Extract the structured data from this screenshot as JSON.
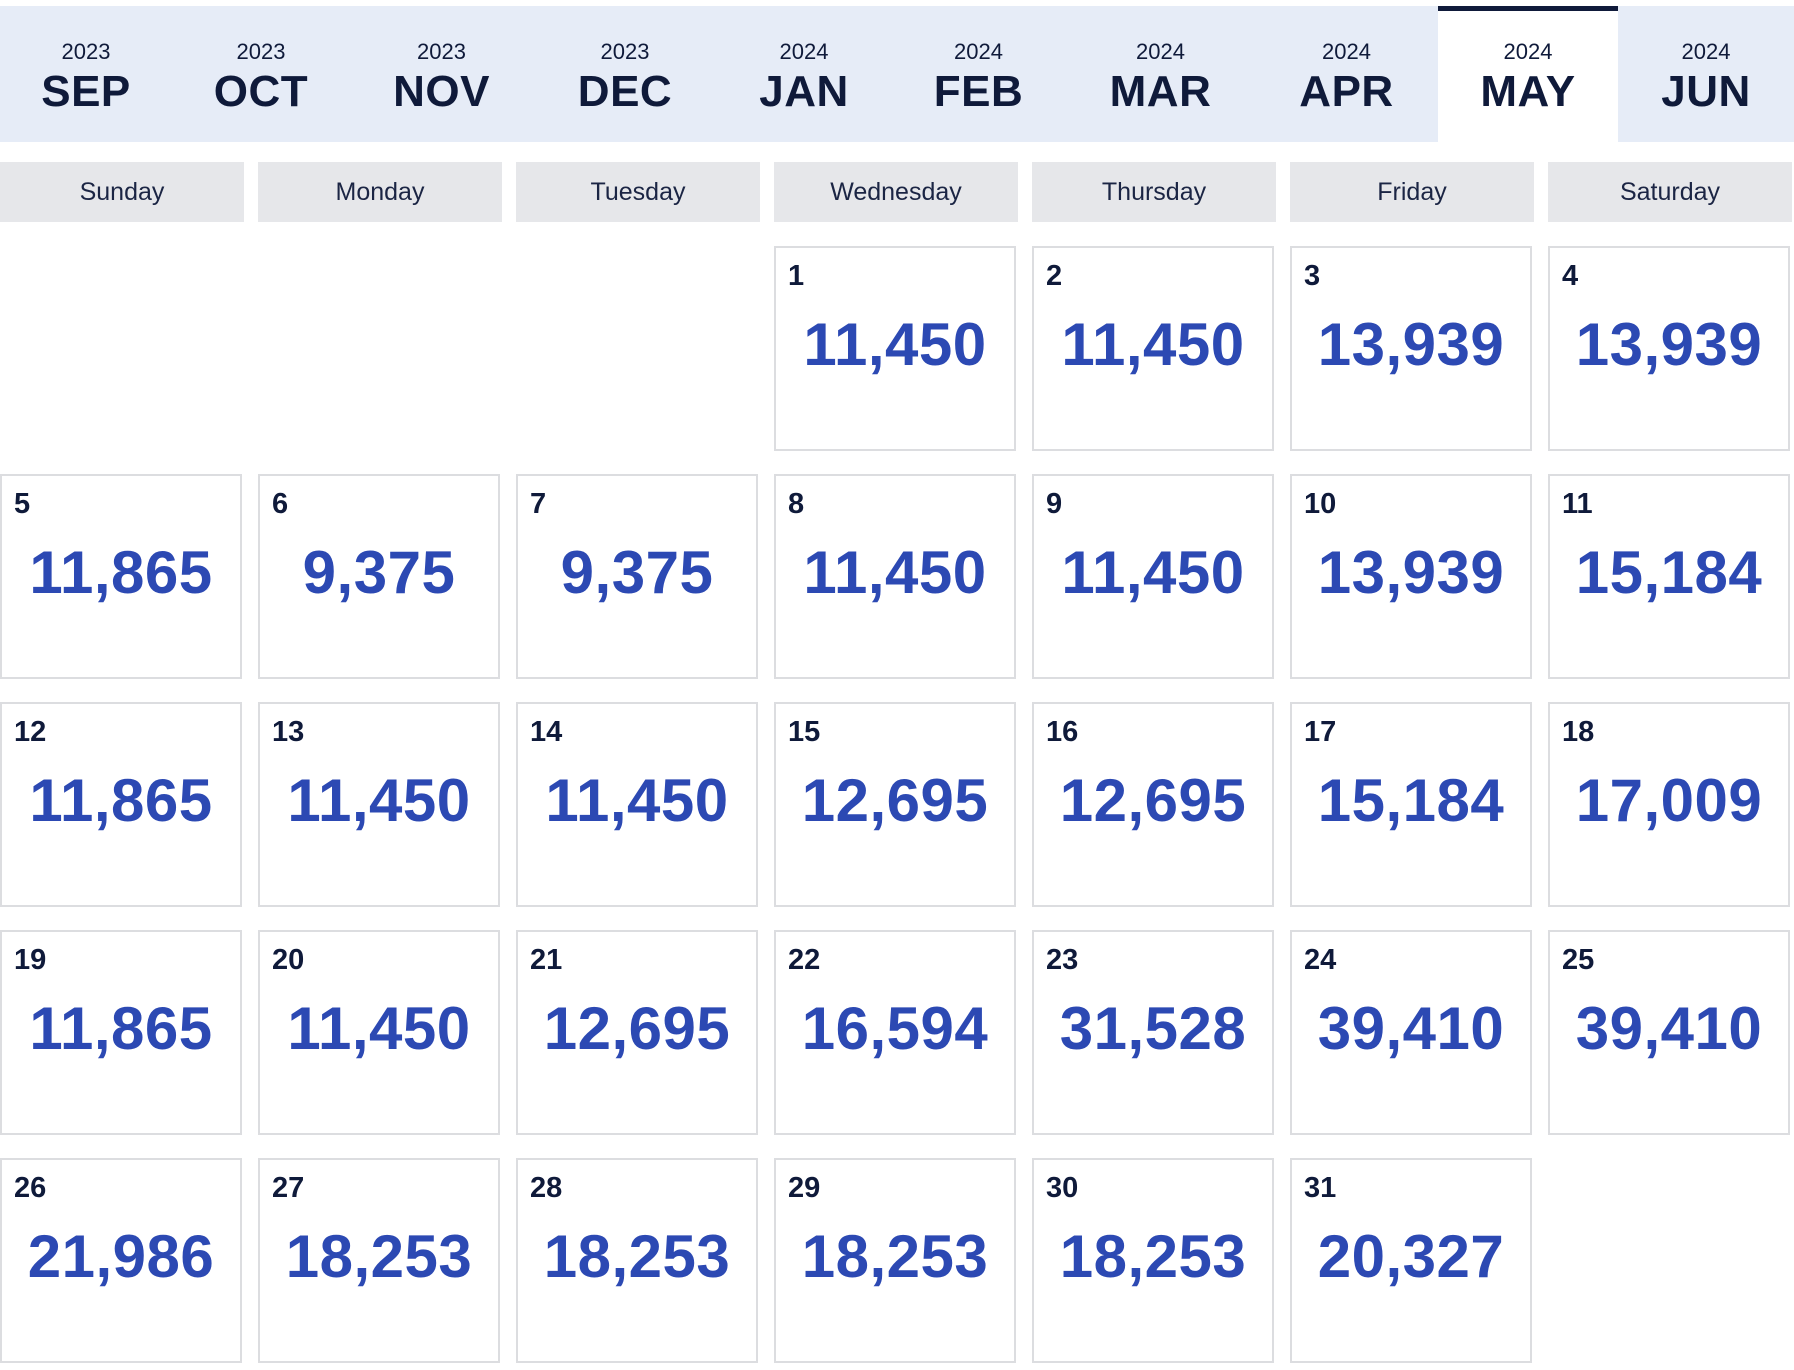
{
  "months": [
    {
      "year": "2023",
      "month": "SEP"
    },
    {
      "year": "2023",
      "month": "OCT"
    },
    {
      "year": "2023",
      "month": "NOV"
    },
    {
      "year": "2023",
      "month": "DEC"
    },
    {
      "year": "2024",
      "month": "JAN"
    },
    {
      "year": "2024",
      "month": "FEB"
    },
    {
      "year": "2024",
      "month": "MAR"
    },
    {
      "year": "2024",
      "month": "APR"
    },
    {
      "year": "2024",
      "month": "MAY"
    },
    {
      "year": "2024",
      "month": "JUN"
    }
  ],
  "active_month": "MAY",
  "weekdays": [
    "Sunday",
    "Monday",
    "Tuesday",
    "Wednesday",
    "Thursday",
    "Friday",
    "Saturday"
  ],
  "first_weekday": 3,
  "days": [
    {
      "day": "1",
      "price": "11,450"
    },
    {
      "day": "2",
      "price": "11,450"
    },
    {
      "day": "3",
      "price": "13,939"
    },
    {
      "day": "4",
      "price": "13,939"
    },
    {
      "day": "5",
      "price": "11,865"
    },
    {
      "day": "6",
      "price": "9,375"
    },
    {
      "day": "7",
      "price": "9,375"
    },
    {
      "day": "8",
      "price": "11,450"
    },
    {
      "day": "9",
      "price": "11,450"
    },
    {
      "day": "10",
      "price": "13,939"
    },
    {
      "day": "11",
      "price": "15,184"
    },
    {
      "day": "12",
      "price": "11,865"
    },
    {
      "day": "13",
      "price": "11,450"
    },
    {
      "day": "14",
      "price": "11,450"
    },
    {
      "day": "15",
      "price": "12,695"
    },
    {
      "day": "16",
      "price": "12,695"
    },
    {
      "day": "17",
      "price": "15,184"
    },
    {
      "day": "18",
      "price": "17,009"
    },
    {
      "day": "19",
      "price": "11,865"
    },
    {
      "day": "20",
      "price": "11,450"
    },
    {
      "day": "21",
      "price": "12,695"
    },
    {
      "day": "22",
      "price": "16,594"
    },
    {
      "day": "23",
      "price": "31,528"
    },
    {
      "day": "24",
      "price": "39,410"
    },
    {
      "day": "25",
      "price": "39,410"
    },
    {
      "day": "26",
      "price": "21,986"
    },
    {
      "day": "27",
      "price": "18,253"
    },
    {
      "day": "28",
      "price": "18,253"
    },
    {
      "day": "29",
      "price": "18,253"
    },
    {
      "day": "30",
      "price": "18,253"
    },
    {
      "day": "31",
      "price": "20,327"
    }
  ],
  "colors": {
    "tab_background": "#e6ecf7",
    "active_tab_background": "#ffffff",
    "active_tab_indicator": "#0f1a3a",
    "weekday_background": "#e6e7ea",
    "price_text": "#2c49b3",
    "dark_text": "#0f1a3a"
  }
}
